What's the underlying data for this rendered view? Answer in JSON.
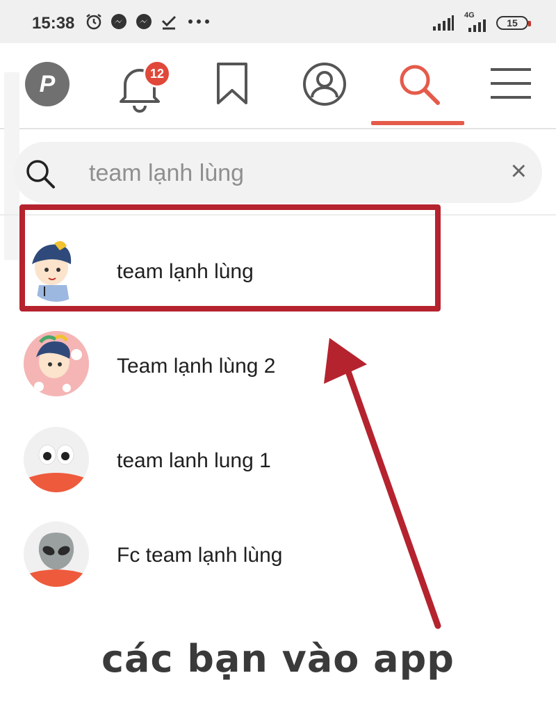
{
  "status_bar": {
    "time": "15:38",
    "network_label": "4G",
    "battery": "15"
  },
  "nav": {
    "avatar_letter": "P",
    "notification_count": "12",
    "active_tab": "search"
  },
  "search": {
    "query": "team lạnh lùng",
    "clear_label": "×"
  },
  "results": [
    {
      "label": "team lạnh lùng",
      "avatar": "boy-cartoon-avatar",
      "highlighted": true
    },
    {
      "label": "Team lạnh lùng 2",
      "avatar": "boy-cartoon-pink-avatar",
      "highlighted": false
    },
    {
      "label": "team lanh lung 1",
      "avatar": "eyes-face-avatar",
      "highlighted": false
    },
    {
      "label": "Fc team lạnh lùng",
      "avatar": "alien-face-avatar",
      "highlighted": false
    }
  ],
  "annotation": {
    "caption_line1": "các bạn vào app",
    "caption_line2": "",
    "color": "#b5232e"
  },
  "colors": {
    "accent": "#e55b4a",
    "highlight": "#b5232e",
    "badge": "#e0483a"
  }
}
